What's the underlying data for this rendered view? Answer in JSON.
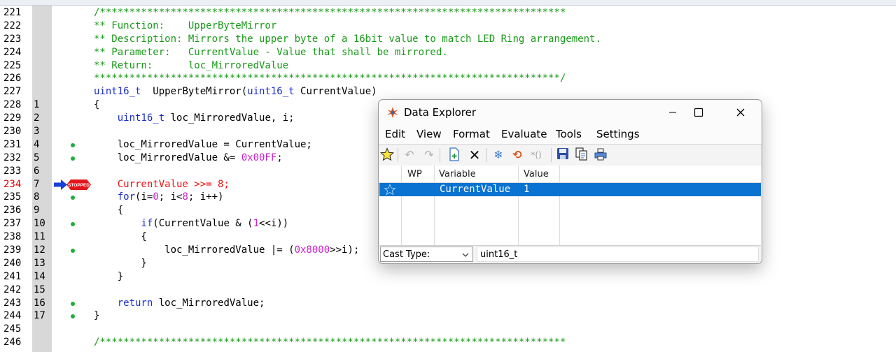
{
  "editor": {
    "current_line": "234",
    "stop_label": "STOPPED",
    "lines": [
      {
        "ln": "221",
        "sn": "",
        "bp": false,
        "parts": [
          [
            "c-green",
            "/*******************************************************************************"
          ]
        ]
      },
      {
        "ln": "222",
        "sn": "",
        "bp": false,
        "parts": [
          [
            "c-green",
            "** Function:    UpperByteMirror"
          ]
        ]
      },
      {
        "ln": "223",
        "sn": "",
        "bp": false,
        "parts": [
          [
            "c-green",
            "** Description: Mirrors the upper byte of a 16bit value to match LED Ring arrangement."
          ]
        ]
      },
      {
        "ln": "224",
        "sn": "",
        "bp": false,
        "parts": [
          [
            "c-green",
            "** Parameter:   CurrentValue - Value that shall be mirrored."
          ]
        ]
      },
      {
        "ln": "225",
        "sn": "",
        "bp": false,
        "parts": [
          [
            "c-green",
            "** Return:      loc_MirroredValue"
          ]
        ]
      },
      {
        "ln": "226",
        "sn": "",
        "bp": false,
        "parts": [
          [
            "c-green",
            "*******************************************************************************/"
          ]
        ]
      },
      {
        "ln": "227",
        "sn": "",
        "bp": false,
        "parts": [
          [
            "c-blue",
            "uint16_t"
          ],
          [
            "",
            "  UpperByteMirror("
          ],
          [
            "c-blue",
            "uint16_t"
          ],
          [
            "",
            " CurrentValue)"
          ]
        ]
      },
      {
        "ln": "228",
        "sn": "1",
        "bp": false,
        "parts": [
          [
            "",
            "{"
          ]
        ]
      },
      {
        "ln": "229",
        "sn": "2",
        "bp": false,
        "parts": [
          [
            "",
            "    "
          ],
          [
            "c-blue",
            "uint16_t"
          ],
          [
            "",
            " loc_MirroredValue, i;"
          ]
        ]
      },
      {
        "ln": "230",
        "sn": "3",
        "bp": false,
        "parts": []
      },
      {
        "ln": "231",
        "sn": "4",
        "bp": true,
        "parts": [
          [
            "",
            "    loc_MirroredValue = CurrentValue;"
          ]
        ]
      },
      {
        "ln": "232",
        "sn": "5",
        "bp": true,
        "parts": [
          [
            "",
            "    loc_MirroredValue &= "
          ],
          [
            "c-mag",
            "0x00FF"
          ],
          [
            "",
            ";"
          ]
        ]
      },
      {
        "ln": "233",
        "sn": "6",
        "bp": false,
        "parts": []
      },
      {
        "ln": "234",
        "sn": "7",
        "bp": false,
        "stop": true,
        "parts": [
          [
            "c-red",
            "    CurrentValue >>= 8;"
          ]
        ]
      },
      {
        "ln": "235",
        "sn": "8",
        "bp": true,
        "parts": [
          [
            "",
            "    "
          ],
          [
            "c-blue",
            "for"
          ],
          [
            "",
            "(i="
          ],
          [
            "c-mag",
            "0"
          ],
          [
            "",
            "; i<"
          ],
          [
            "c-mag",
            "8"
          ],
          [
            "",
            "; i++)"
          ]
        ]
      },
      {
        "ln": "236",
        "sn": "9",
        "bp": false,
        "parts": [
          [
            "",
            "    {"
          ]
        ]
      },
      {
        "ln": "237",
        "sn": "10",
        "bp": true,
        "parts": [
          [
            "",
            "        "
          ],
          [
            "c-blue",
            "if"
          ],
          [
            "",
            "(CurrentValue & ("
          ],
          [
            "c-mag",
            "1"
          ],
          [
            "",
            "<<i))"
          ]
        ]
      },
      {
        "ln": "238",
        "sn": "11",
        "bp": false,
        "parts": [
          [
            "",
            "        {"
          ]
        ]
      },
      {
        "ln": "239",
        "sn": "12",
        "bp": true,
        "parts": [
          [
            "",
            "            loc_MirroredValue |= ("
          ],
          [
            "c-mag",
            "0x8000"
          ],
          [
            "",
            ">>i);"
          ]
        ]
      },
      {
        "ln": "240",
        "sn": "13",
        "bp": false,
        "parts": [
          [
            "",
            "        }"
          ]
        ]
      },
      {
        "ln": "241",
        "sn": "14",
        "bp": false,
        "parts": [
          [
            "",
            "    }"
          ]
        ]
      },
      {
        "ln": "242",
        "sn": "15",
        "bp": false,
        "parts": []
      },
      {
        "ln": "243",
        "sn": "16",
        "bp": true,
        "parts": [
          [
            "",
            "    "
          ],
          [
            "c-blue",
            "return"
          ],
          [
            "",
            " loc_MirroredValue;"
          ]
        ]
      },
      {
        "ln": "244",
        "sn": "17",
        "bp": true,
        "parts": [
          [
            "",
            "}"
          ]
        ]
      },
      {
        "ln": "245",
        "sn": "",
        "bp": false,
        "parts": []
      },
      {
        "ln": "246",
        "sn": "",
        "bp": false,
        "parts": [
          [
            "c-green",
            "/*******************************************************************************"
          ]
        ]
      }
    ]
  },
  "dialog": {
    "title": "Data Explorer",
    "menu": [
      "Edit",
      "View",
      "Format",
      "Evaluate",
      "Tools",
      "Settings"
    ],
    "columns": {
      "wp": "WP",
      "variable": "Variable",
      "value": "Value"
    },
    "row": {
      "variable": "CurrentValue",
      "value": "1"
    },
    "cast_label": "Cast Type:",
    "cast_value": "uint16_t",
    "colors": {
      "selection": "#0a72d0"
    }
  }
}
